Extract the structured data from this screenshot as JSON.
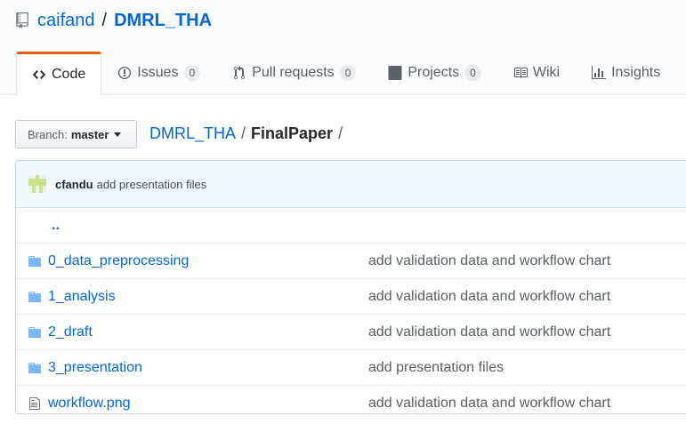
{
  "repo": {
    "owner": "caifand",
    "separator": "/",
    "name": "DMRL_THA"
  },
  "tabs": [
    {
      "label": "Code",
      "icon": "code-icon",
      "selected": true
    },
    {
      "label": "Issues",
      "icon": "issue-icon",
      "count": "0"
    },
    {
      "label": "Pull requests",
      "icon": "pull-request-icon",
      "count": "0"
    },
    {
      "label": "Projects",
      "icon": "project-icon",
      "count": "0"
    },
    {
      "label": "Wiki",
      "icon": "book-icon"
    },
    {
      "label": "Insights",
      "icon": "graph-icon"
    }
  ],
  "branch": {
    "label": "Branch:",
    "name": "master"
  },
  "breadcrumb": {
    "root": "DMRL_THA",
    "sep1": "/",
    "current": "FinalPaper",
    "sep2": "/"
  },
  "commit": {
    "author": "cfandu",
    "message": "add presentation files"
  },
  "files": {
    "updir": "..",
    "rows": [
      {
        "name": "0_data_preprocessing",
        "type": "folder",
        "message": "add validation data and workflow chart"
      },
      {
        "name": "1_analysis",
        "type": "folder",
        "message": "add validation data and workflow chart"
      },
      {
        "name": "2_draft",
        "type": "folder",
        "message": "add validation data and workflow chart"
      },
      {
        "name": "3_presentation",
        "type": "folder",
        "message": "add presentation files"
      },
      {
        "name": "workflow.png",
        "type": "file",
        "message": "add validation data and workflow chart"
      }
    ]
  },
  "colors": {
    "link": "#0366d6",
    "selected_tab_accent": "#e36209",
    "folder": "#79b8ff",
    "commit_bar": "#f1f8ff"
  }
}
